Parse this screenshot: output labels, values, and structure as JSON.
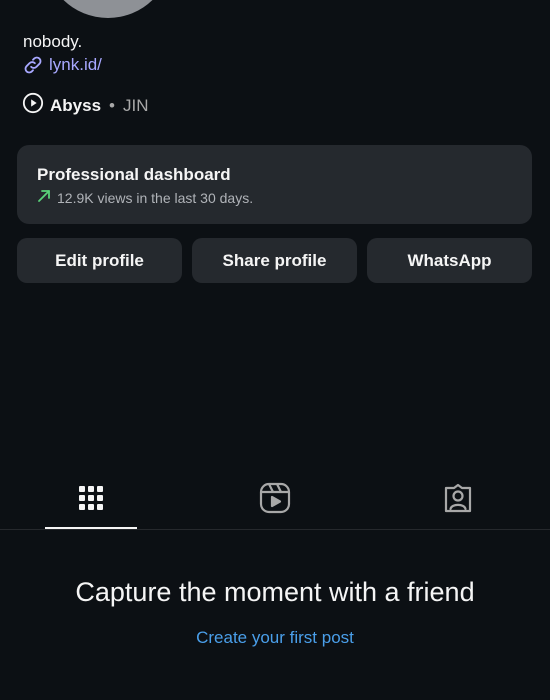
{
  "profile": {
    "name": "nobody.",
    "link": "lynk.id/"
  },
  "music": {
    "title": "Abyss",
    "separator": "•",
    "artist": "JIN"
  },
  "dashboard": {
    "title": "Professional dashboard",
    "views": "12.9K views in the last 30 days."
  },
  "buttons": {
    "edit": "Edit profile",
    "share": "Share profile",
    "whatsapp": "WhatsApp"
  },
  "tabs": {
    "items": [
      "grid-icon",
      "reels-icon",
      "tagged-icon"
    ],
    "active": "grid-icon"
  },
  "empty_state": {
    "title": "Capture the moment with a friend",
    "cta": "Create your first post"
  },
  "colors": {
    "background": "#0c1014",
    "card": "#25292e",
    "link": "#a8a8ff",
    "accent_blue": "#4a9fea",
    "trend_green": "#5ad27a"
  }
}
